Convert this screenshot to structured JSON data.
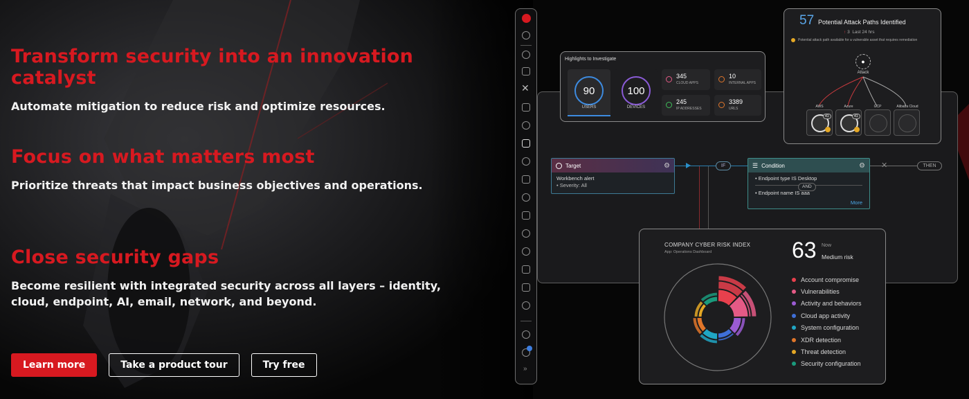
{
  "hero": {
    "sections": [
      {
        "heading": "Transform security into an innovation catalyst",
        "text": "Automate mitigation to reduce risk and optimize resources."
      },
      {
        "heading": "Focus on what matters most",
        "text": "Prioritize threats that impact business objectives and operations."
      },
      {
        "heading": "Close security gaps",
        "text": "Become resilient with integrated security across all layers – identity, cloud, endpoint, AI, email, network, and beyond."
      }
    ],
    "buttons": {
      "learn_more": "Learn more",
      "product_tour": "Take a product tour",
      "try_free": "Try free"
    }
  },
  "highlights": {
    "title": "Highlights to Investigate",
    "users_value": "90",
    "users_label": "USERS",
    "devices_value": "100",
    "devices_label": "DEVICES",
    "cloud_apps_value": "345",
    "cloud_apps_label": "CLOUD APPS",
    "internal_apps_value": "10",
    "internal_apps_label": "INTERNAL APPS",
    "ip_value": "245",
    "ip_label": "IP ADDRESSES",
    "urls_value": "3389",
    "urls_label": "URLS"
  },
  "attack_paths": {
    "count": "57",
    "title": "Potential Attack Paths Identified",
    "change": "3",
    "period": "Last 24 hrs",
    "note": "Potential attack path available for a vulnerable asset that requires remediation",
    "root": "Attack",
    "targets": [
      {
        "name": "AWS",
        "badge": "41"
      },
      {
        "name": "Azure",
        "badge": "41"
      },
      {
        "name": "GCP",
        "badge": ""
      },
      {
        "name": "Alibaba Cloud",
        "badge": ""
      }
    ]
  },
  "workflow": {
    "target_title": "Target",
    "target_line1": "Workbench alert",
    "target_line2": "Severity: All",
    "if_label": "IF",
    "condition_title": "Condition",
    "condition_line1": "Endpoint type IS Desktop",
    "and_label": "AND",
    "condition_line2": "Endpoint name IS aaa",
    "more_label": "More",
    "then_label": "THEN"
  },
  "risk": {
    "title": "COMPANY CYBER RISK INDEX",
    "subtitle": "App: Operations Dashboard",
    "value": "63",
    "now_label": "Now",
    "level": "Medium risk",
    "legend": [
      {
        "label": "Account compromise",
        "color": "#e8404d"
      },
      {
        "label": "Vulnerabilities",
        "color": "#e55a86"
      },
      {
        "label": "Activity and behaviors",
        "color": "#9b5bd3"
      },
      {
        "label": "Cloud app activity",
        "color": "#3f6fd8"
      },
      {
        "label": "System configuration",
        "color": "#20a6c4"
      },
      {
        "label": "XDR detection",
        "color": "#e0762a"
      },
      {
        "label": "Threat detection",
        "color": "#e5a825"
      },
      {
        "label": "Security configuration",
        "color": "#1a9a7c"
      }
    ]
  }
}
